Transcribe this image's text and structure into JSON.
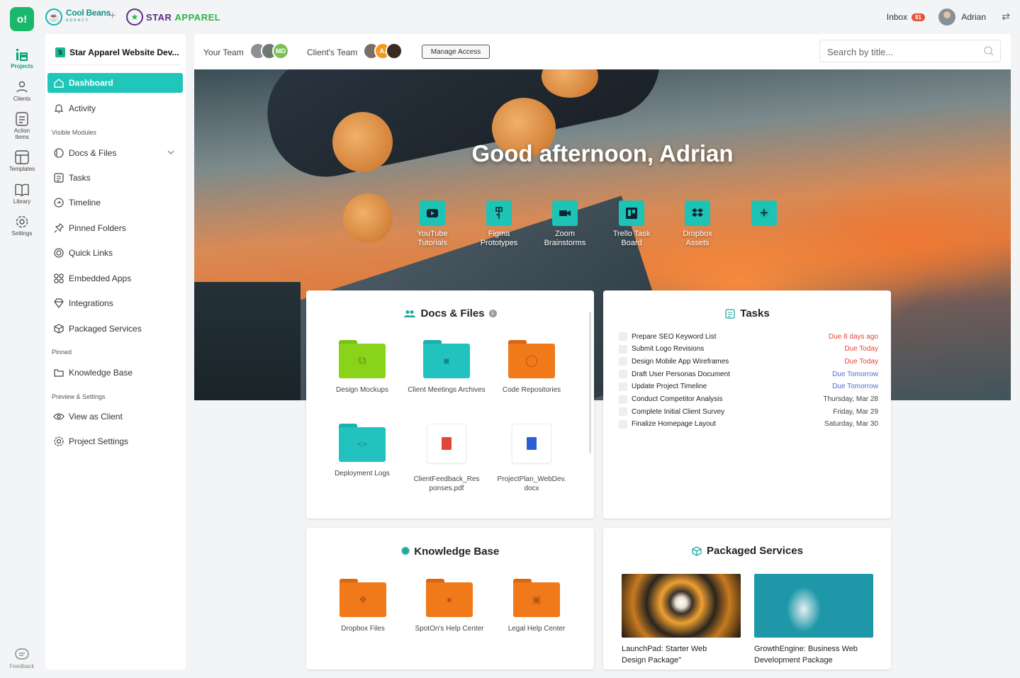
{
  "rail": {
    "logo": "o!",
    "items": [
      {
        "label": "Projects",
        "icon": "projects-icon"
      },
      {
        "label": "Clients",
        "icon": "clients-icon"
      },
      {
        "label": "Action Items",
        "icon": "action-items-icon"
      },
      {
        "label": "Templates",
        "icon": "templates-icon"
      },
      {
        "label": "Library",
        "icon": "library-icon"
      },
      {
        "label": "Settings",
        "icon": "settings-icon"
      }
    ],
    "feedback": "Feedback"
  },
  "topbar": {
    "brand1": "Cool Beans",
    "brand1_sub": "AGENCY",
    "brand2a": "STAR ",
    "brand2b": "APPAREL",
    "inbox": "Inbox",
    "inbox_count": "81",
    "user": "Adrian"
  },
  "sidebar": {
    "project": "Star Apparel Website Dev...",
    "project_initial": "S",
    "dashboard": "Dashboard",
    "activity": "Activity",
    "visible_modules": "Visible Modules",
    "modules": [
      "Docs & Files",
      "Tasks",
      "Timeline",
      "Pinned Folders",
      "Quick Links",
      "Embedded Apps",
      "Integrations",
      "Packaged Services"
    ],
    "pinned": "Pinned",
    "knowledge": "Knowledge Base",
    "preview": "Preview & Settings",
    "view_client": "View as Client",
    "project_settings": "Project Settings"
  },
  "header": {
    "your_team": "Your Team",
    "your_team_initials": "MD",
    "clients_team": "Client's Team",
    "clients_initials": "A.",
    "manage": "Manage Access",
    "search_placeholder": "Search by title..."
  },
  "hero": {
    "greeting": "Good afternoon, Adrian",
    "links": [
      {
        "l1": "YouTube",
        "l2": "Tutorials",
        "icon": "youtube-icon"
      },
      {
        "l1": "Figma",
        "l2": "Prototypes",
        "icon": "figma-icon"
      },
      {
        "l1": "Zoom",
        "l2": "Brainstorms",
        "icon": "zoom-icon"
      },
      {
        "l1": "Trello Task",
        "l2": "Board",
        "icon": "trello-icon"
      },
      {
        "l1": "Dropbox",
        "l2": "Assets",
        "icon": "dropbox-icon"
      }
    ]
  },
  "docs": {
    "title": "Docs & Files",
    "items": [
      {
        "name": "Design Mockups",
        "color": "#8ad31b"
      },
      {
        "name": "Client Meetings Archives",
        "color": "#22c2bf"
      },
      {
        "name": "Code Repositories",
        "color": "#f07a1a"
      },
      {
        "name": "Deployment Logs",
        "color": "#22c2bf"
      },
      {
        "name": "ClientFeedback_Responses.pdf"
      },
      {
        "name": "ProjectPlan_WebDev.docx"
      }
    ]
  },
  "tasks": {
    "title": "Tasks",
    "items": [
      {
        "name": "Prepare SEO Keyword List",
        "due": "Due 8 days ago",
        "color": "#e0473a"
      },
      {
        "name": "Submit Logo Revisions",
        "due": "Due Today",
        "color": "#e0473a"
      },
      {
        "name": "Design Mobile App Wireframes",
        "due": "Due Today",
        "color": "#e0473a"
      },
      {
        "name": "Draft User Personas Document",
        "due": "Due Tomorrow",
        "color": "#4a6fd8"
      },
      {
        "name": "Update Project Timeline",
        "due": "Due Tomorrow",
        "color": "#4a6fd8"
      },
      {
        "name": "Conduct Competitor Analysis",
        "due": "Thursday, Mar 28",
        "color": "#444444"
      },
      {
        "name": "Complete Initial Client Survey",
        "due": "Friday, Mar 29",
        "color": "#444444"
      },
      {
        "name": "Finalize Homepage Layout",
        "due": "Saturday, Mar 30",
        "color": "#444444"
      }
    ]
  },
  "kb": {
    "title": "Knowledge Base",
    "items": [
      {
        "name": "Dropbox Files"
      },
      {
        "name": "SpotOn's Help Center"
      },
      {
        "name": "Legal Help Center"
      }
    ]
  },
  "services": {
    "title": "Packaged Services",
    "items": [
      {
        "l1": "LaunchPad: Starter Web",
        "l2": "Design Package\""
      },
      {
        "l1": "GrowthEngine: Business Web",
        "l2": "Development Package"
      }
    ]
  },
  "colors": {
    "accent": "#20c6b9",
    "brand_green": "#1ab86a",
    "purple": "#5a2d82"
  }
}
